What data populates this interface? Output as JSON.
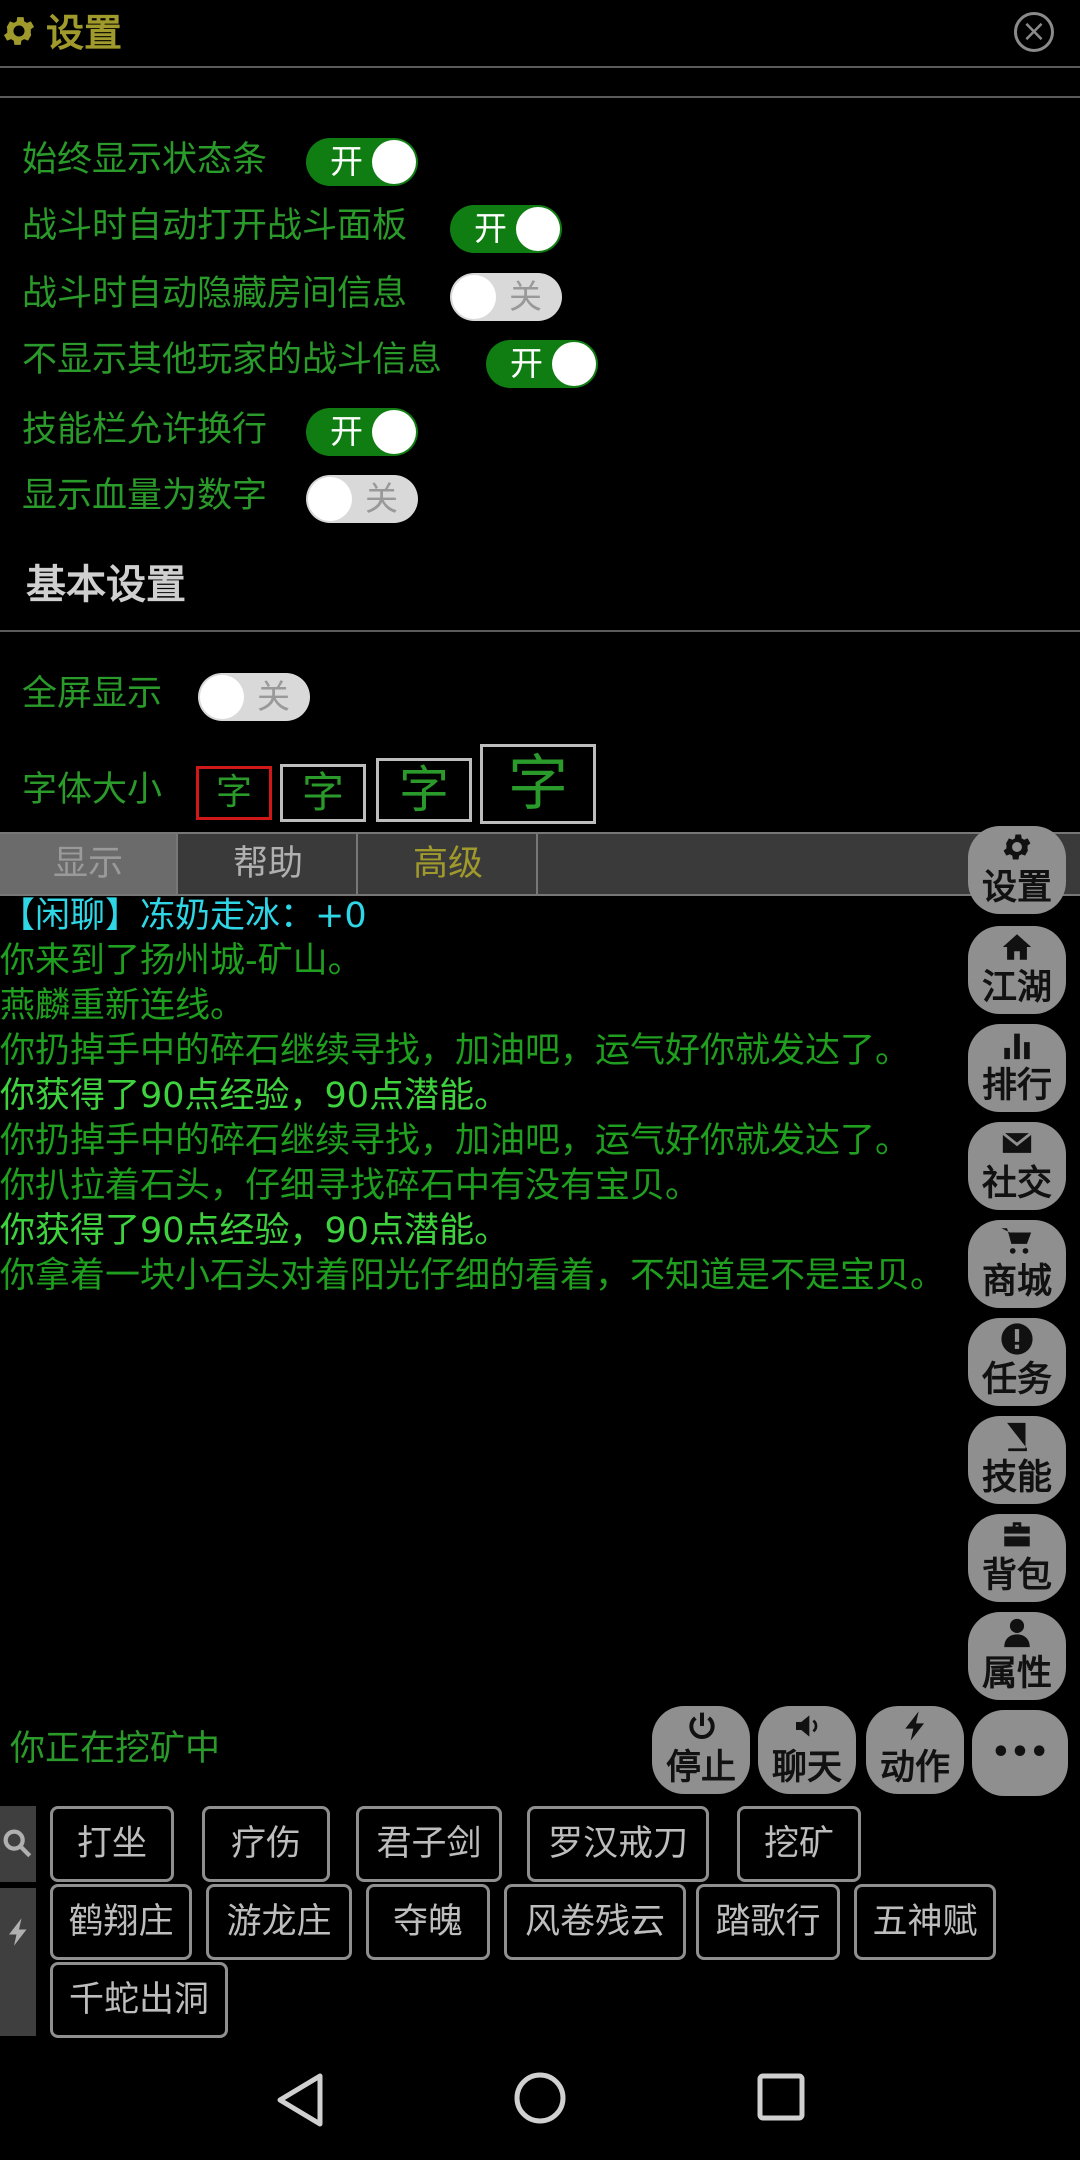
{
  "header": {
    "title": "设置"
  },
  "toggles": [
    {
      "label": "始终显示状态条",
      "state": "开"
    },
    {
      "label": "战斗时自动打开战斗面板",
      "state": "开"
    },
    {
      "label": "战斗时自动隐藏房间信息",
      "state": "关"
    },
    {
      "label": "不显示其他玩家的战斗信息",
      "state": "开"
    },
    {
      "label": "技能栏允许换行",
      "state": "开"
    },
    {
      "label": "显示血量为数字",
      "state": "关"
    }
  ],
  "basic": {
    "title": "基本设置",
    "fullscreen": {
      "label": "全屏显示",
      "state": "关"
    },
    "font_size": {
      "label": "字体大小",
      "options": [
        "字",
        "字",
        "字",
        "字"
      ]
    }
  },
  "tabs": [
    "显示",
    "帮助",
    "高级"
  ],
  "log": [
    "【闲聊】冻奶走冰：+0",
    "你来到了扬州城-矿山。",
    "燕麟重新连线。",
    "你扔掉手中的碎石继续寻找，加油吧，运气好你就发达了。",
    "你获得了90点经验，90点潜能。",
    "你扔掉手中的碎石继续寻找，加油吧，运气好你就发达了。",
    "你扒拉着石头，仔细寻找碎石中有没有宝贝。",
    "你获得了90点经验，90点潜能。",
    "你拿着一块小石头对着阳光仔细的看着，不知道是不是宝贝。"
  ],
  "side_menu": [
    {
      "label": "设置",
      "icon": "gear-icon"
    },
    {
      "label": "江湖",
      "icon": "home-icon"
    },
    {
      "label": "排行",
      "icon": "bar-chart-icon"
    },
    {
      "label": "社交",
      "icon": "envelope-icon"
    },
    {
      "label": "商城",
      "icon": "cart-icon"
    },
    {
      "label": "任务",
      "icon": "exclamation-icon"
    },
    {
      "label": "技能",
      "icon": "book-icon"
    },
    {
      "label": "背包",
      "icon": "briefcase-icon"
    },
    {
      "label": "属性",
      "icon": "person-icon"
    }
  ],
  "status": {
    "text": "你正在挖矿中"
  },
  "actions": [
    {
      "label": "停止",
      "icon": "power-icon"
    },
    {
      "label": "聊天",
      "icon": "speaker-icon"
    },
    {
      "label": "动作",
      "icon": "lightning-icon"
    }
  ],
  "more_label": "•••",
  "skills_row1": [
    "打坐",
    "疗伤",
    "君子剑",
    "罗汉戒刀",
    "挖矿"
  ],
  "skills_row2": [
    "鹤翔庄",
    "游龙庄",
    "夺魄",
    "风卷残云",
    "踏歌行",
    "五神赋"
  ],
  "skills_row3": [
    "千蛇出洞"
  ],
  "colors": {
    "header": "#a09a2c",
    "text_green": "#2a9a2a",
    "bright_green": "#3fd23f",
    "cyan": "#2fd6e6",
    "toggle_on": "#0f7d12",
    "active_tab": "#a09a2c"
  }
}
